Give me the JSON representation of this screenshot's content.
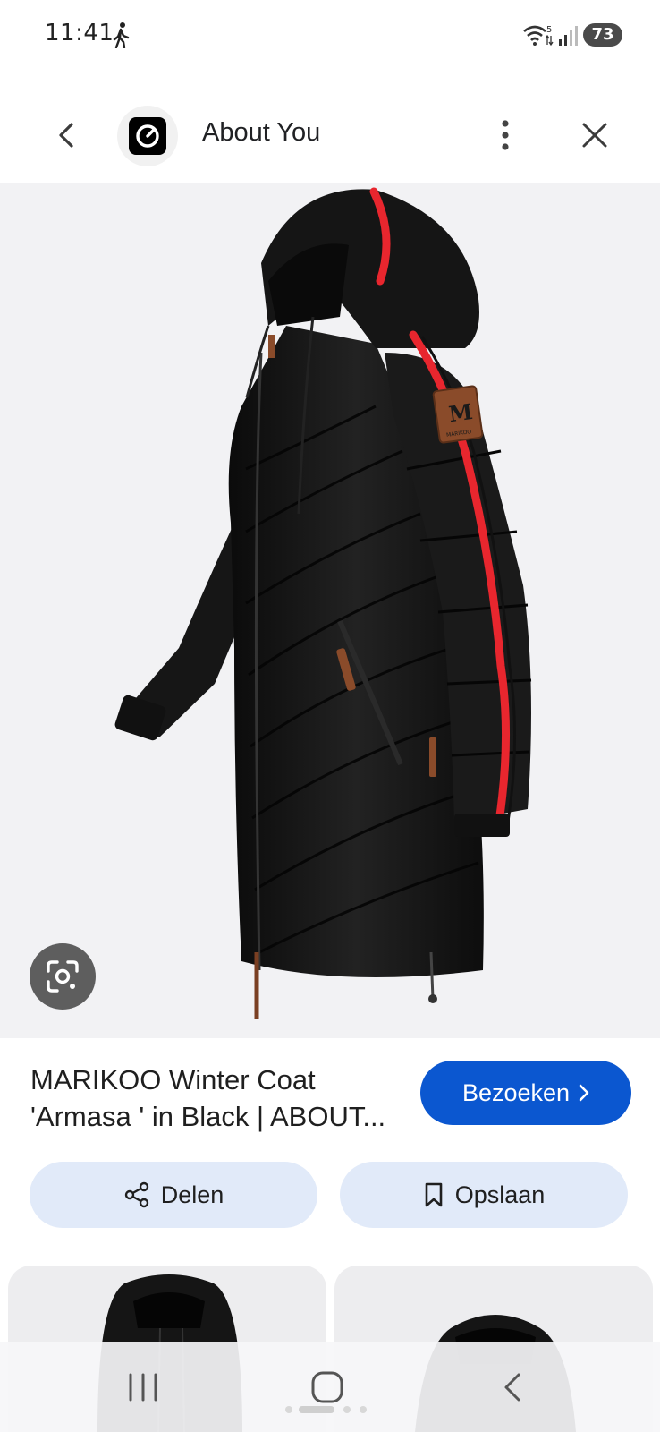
{
  "status_bar": {
    "time": "11:41",
    "battery": "73",
    "wifi_label": "5"
  },
  "header": {
    "site_name": "About You"
  },
  "product": {
    "title_line1": "MARIKOO Winter Coat",
    "title_line2": "'Armasa ' in Black | ABOUT...",
    "visit_label": "Bezoeken",
    "share_label": "Delen",
    "save_label": "Opslaan"
  },
  "product_image": {
    "patch_letter": "M",
    "patch_text": "MARIKOO",
    "accent_stripe_color": "#e8262e",
    "coat_color": "#141414",
    "patch_color": "#8a4b2a"
  },
  "colors": {
    "primary_button": "#0b57d0",
    "tonal_button": "#e1eaf9",
    "image_background": "#f2f2f4"
  },
  "icons": {
    "back": "chevron-left-icon",
    "menu": "more-vert-icon",
    "close": "close-icon",
    "lens": "google-lens-icon",
    "share": "share-icon",
    "save": "bookmark-icon",
    "visit": "chevron-right-icon"
  }
}
